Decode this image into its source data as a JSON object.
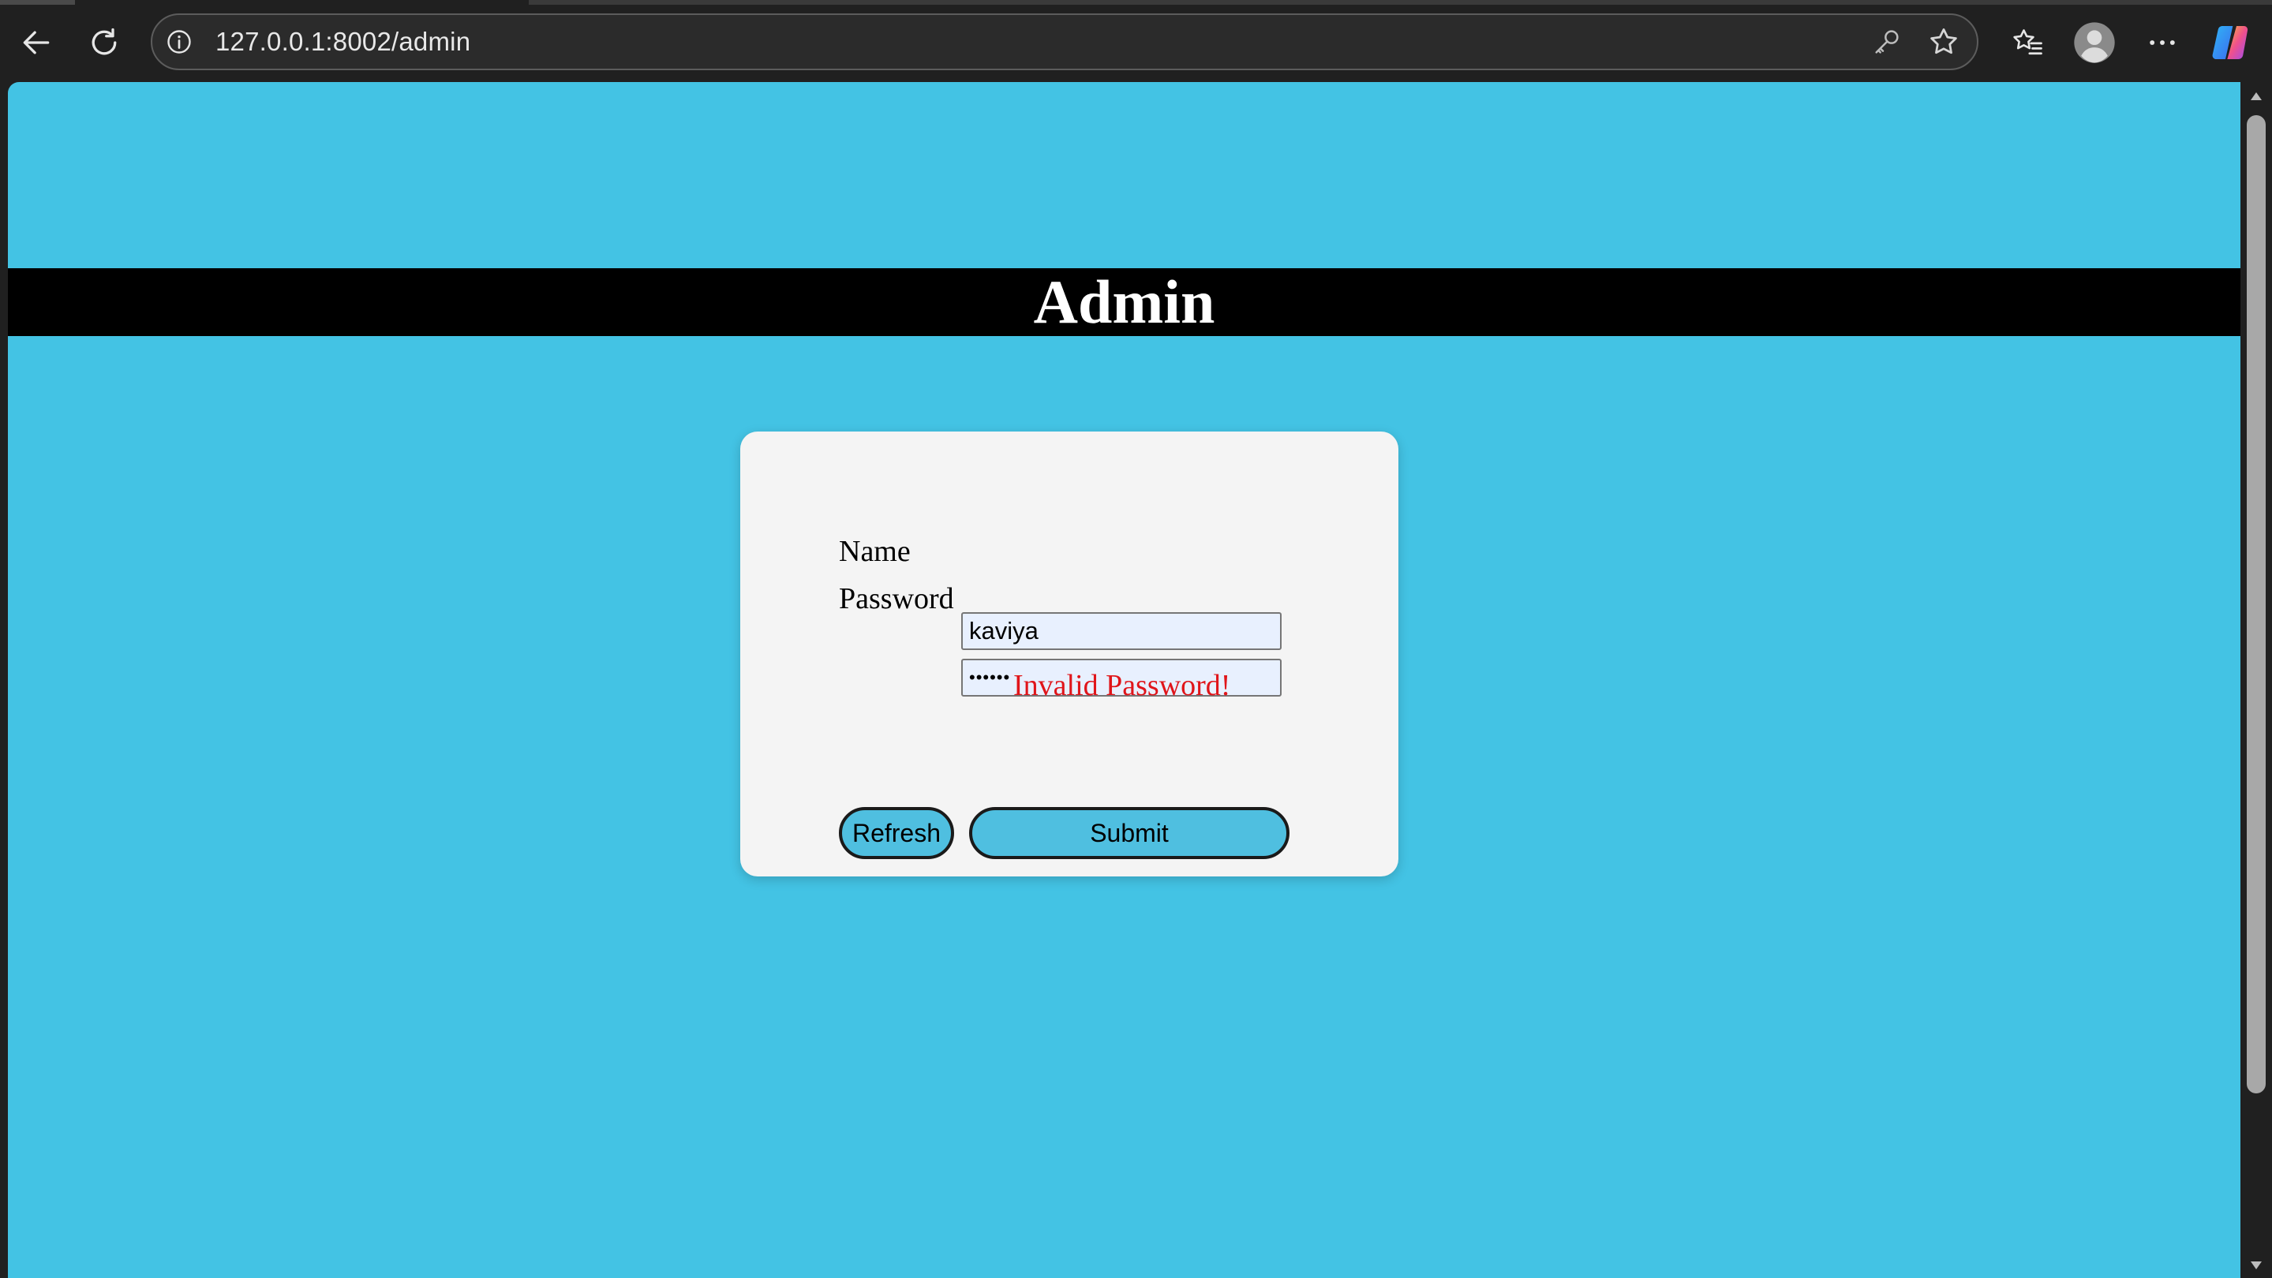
{
  "browser": {
    "url": "127.0.0.1:8002/admin",
    "icons": [
      "back-arrow-icon",
      "reload-icon",
      "site-info-icon",
      "key-icon",
      "star-icon",
      "favorites-icon",
      "profile-avatar-icon",
      "more-menu-icon",
      "copilot-icon"
    ]
  },
  "page": {
    "header_title": "Admin",
    "background_color": "#43c3e4",
    "form": {
      "name_label": "Name",
      "name_value": "kaviya",
      "password_label": "Password",
      "password_value": "••••••",
      "error_message": "Invalid Password!",
      "error_color": "#e0151a",
      "refresh_label": "Refresh",
      "submit_label": "Submit"
    }
  }
}
